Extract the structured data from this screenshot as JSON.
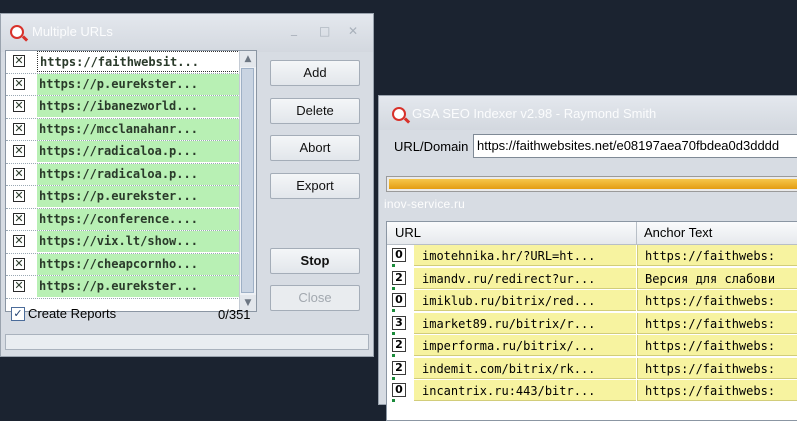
{
  "win_multi": {
    "title": "Multiple URLs",
    "controls": {
      "minimize": "_",
      "maximize": "□",
      "close": "✕"
    },
    "check_mark": "✕",
    "urls": [
      "https://faithwebsit...",
      "https://p.eurekster...",
      "https://ibanezworld...",
      "https://mcclanahanr...",
      "https://radicaloa.p...",
      "https://radicaloa.p...",
      "https://p.eurekster...",
      "https://conference....",
      "https://vix.lt/show...",
      "https://cheapcornho...",
      "https://p.eurekster..."
    ],
    "buttons": {
      "add": "Add",
      "delete": "Delete",
      "abort": "Abort",
      "export": "Export",
      "stop": "Stop",
      "close": "Close"
    },
    "create_reports_label": "Create Reports",
    "create_reports_checked": "✓",
    "counter": "0/351"
  },
  "win_gsa": {
    "title": "GSA SEO Indexer v2.98 - Raymond Smith",
    "url_domain_label": "URL/Domain",
    "url_domain_value": "https://faithwebsites.net/e08197aea70fbdea0d3dddd",
    "progress_text": "inov-service.ru",
    "progress_fraction": 1.0,
    "columns": {
      "url": "URL",
      "anchor": "Anchor Text"
    },
    "rows": [
      {
        "count": "0",
        "url": "imotehnika.hr/?URL=ht...",
        "anchor": "https://faithwebs:"
      },
      {
        "count": "2",
        "url": "imandv.ru/redirect?ur...",
        "anchor": "Версия для слабови"
      },
      {
        "count": "0",
        "url": "imiklub.ru/bitrix/red...",
        "anchor": "https://faithwebs:"
      },
      {
        "count": "3",
        "url": "imarket89.ru/bitrix/r...",
        "anchor": "https://faithwebs:"
      },
      {
        "count": "2",
        "url": "imperforma.ru/bitrix/...",
        "anchor": "https://faithwebs:"
      },
      {
        "count": "2",
        "url": "indemit.com/bitrix/rk...",
        "anchor": "https://faithwebs:"
      },
      {
        "count": "0",
        "url": "incantrix.ru:443/bitr...",
        "anchor": "https://faithwebs:"
      }
    ]
  }
}
